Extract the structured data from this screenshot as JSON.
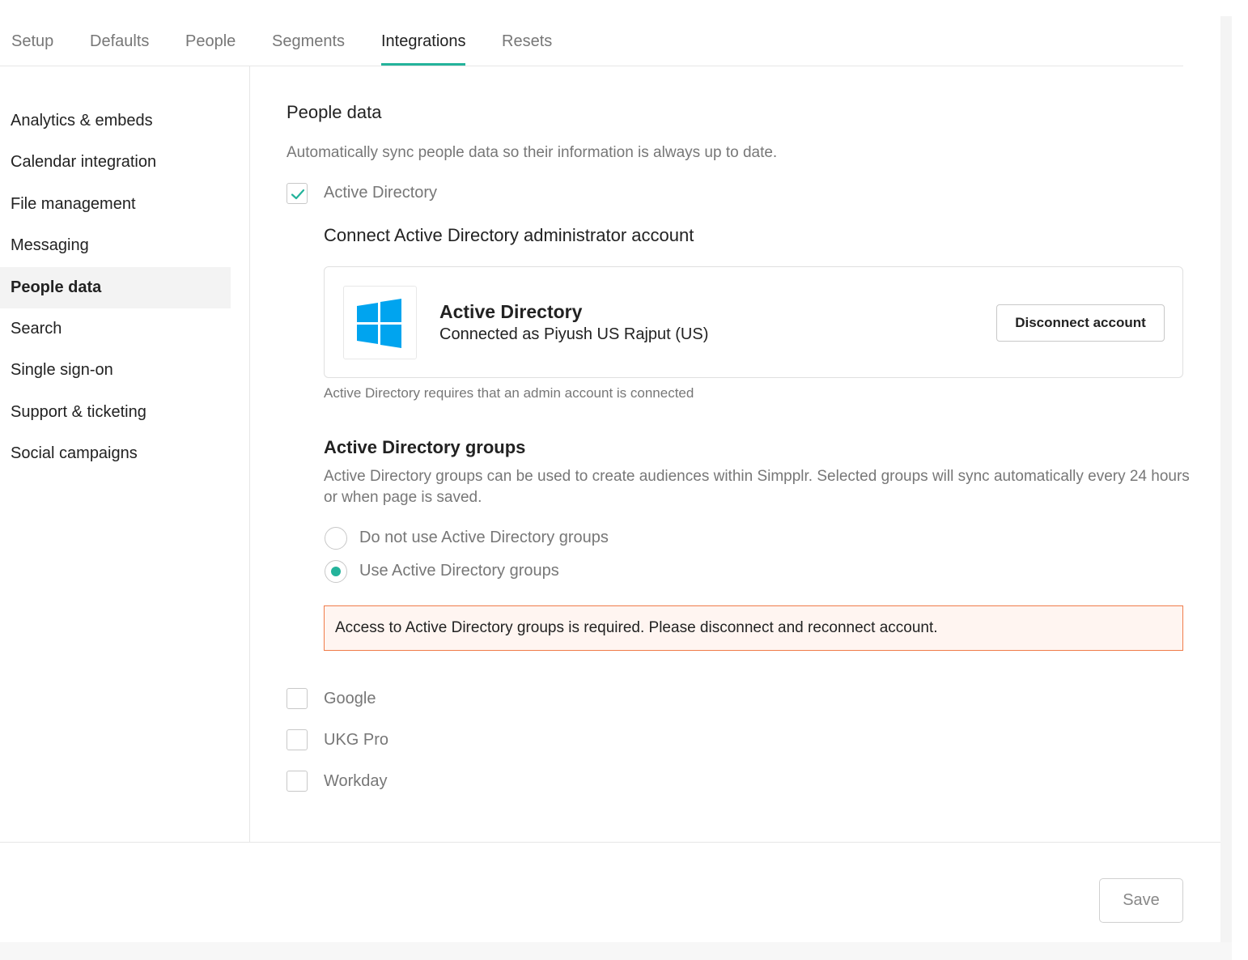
{
  "tabs": [
    "Setup",
    "Defaults",
    "People",
    "Segments",
    "Integrations",
    "Resets"
  ],
  "active_tab": "Integrations",
  "sidebar": {
    "items": [
      "Analytics & embeds",
      "Calendar integration",
      "File management",
      "Messaging",
      "People data",
      "Search",
      "Single sign-on",
      "Support & ticketing",
      "Social campaigns"
    ],
    "active": "People data"
  },
  "section": {
    "title": "People data",
    "description": "Automatically sync people data so their information is always up to date."
  },
  "providers": {
    "active_directory": {
      "label": "Active Directory",
      "checked": true
    },
    "google": {
      "label": "Google",
      "checked": false
    },
    "ukg_pro": {
      "label": "UKG Pro",
      "checked": false
    },
    "workday": {
      "label": "Workday",
      "checked": false
    }
  },
  "connect": {
    "title": "Connect Active Directory administrator account",
    "card_title": "Active Directory",
    "card_subtitle": "Connected as Piyush US Rajput (US)",
    "disconnect_label": "Disconnect account",
    "logo_icon": "windows-logo",
    "logo_color": "#00a4ef",
    "note": "Active Directory requires that an admin account is connected"
  },
  "groups": {
    "title": "Active Directory groups",
    "description": "Active Directory groups can be used to create audiences within Simpplr. Selected groups will sync automatically every 24 hours or when page is saved.",
    "options": [
      {
        "label": "Do not use Active Directory groups",
        "selected": false
      },
      {
        "label": "Use Active Directory groups",
        "selected": true
      }
    ],
    "alert": "Access to Active Directory groups is required. Please disconnect and reconnect account."
  },
  "footer": {
    "save_label": "Save"
  },
  "colors": {
    "accent": "#24b39b",
    "alert_border": "#f07c4a",
    "alert_bg": "#fff5f1"
  }
}
